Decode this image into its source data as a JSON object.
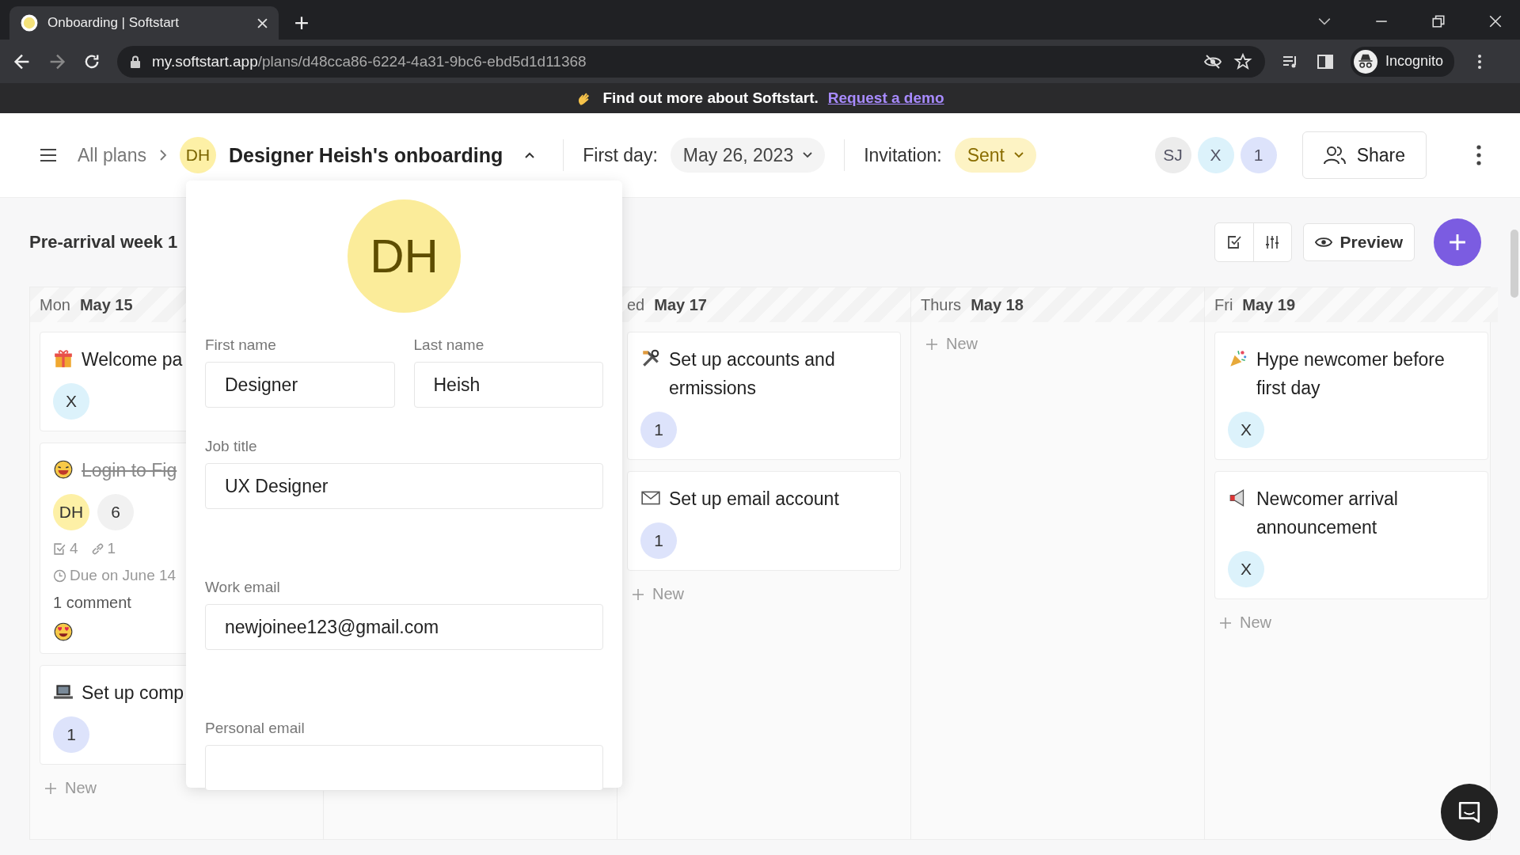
{
  "browser": {
    "tab": {
      "title": "Onboarding | Softstart"
    },
    "url": {
      "host": "my.softstart.app",
      "path": "/plans/d48cca86-6224-4a31-9bc6-ebd5d1d11368"
    },
    "profile": "Incognito"
  },
  "banner": {
    "text": "Find out more about Softstart.",
    "link": "Request a demo"
  },
  "header": {
    "breadcrumb": "All plans",
    "plan_avatar": "DH",
    "plan_title": "Designer Heish's onboarding",
    "first_day_label": "First day:",
    "first_day": "May 26, 2023",
    "invitation_label": "Invitation:",
    "invitation_status": "Sent",
    "members": [
      {
        "label": "SJ",
        "color": "#ececec"
      },
      {
        "label": "X",
        "color": "#dcf2fb"
      },
      {
        "label": "1",
        "color": "#dde3fb"
      }
    ],
    "share": "Share"
  },
  "toolbar": {
    "week_title": "Pre-arrival week 1",
    "preview": "Preview"
  },
  "columns": [
    {
      "day": "Mon",
      "date": "May 15",
      "new": "New",
      "cards": [
        {
          "title": "Welcome pa",
          "done": false,
          "assignees": [
            {
              "label": "X",
              "color": "#dcf2fb"
            }
          ]
        },
        {
          "title": "Login to Fig",
          "done": true,
          "assignees": [
            {
              "label": "DH",
              "color": "#fdf0a6"
            },
            {
              "label": "6",
              "color": "#f1f1f1"
            }
          ],
          "checklist": "4",
          "links": "1",
          "due": "Due on June 14",
          "comments": "1 comment"
        },
        {
          "title": "Set up comp",
          "done": false,
          "assignees": [
            {
              "label": "1",
              "color": "#dde3fb"
            }
          ]
        }
      ]
    },
    {},
    {
      "day": "ed",
      "date": "May 17",
      "new": "New",
      "cards": [
        {
          "title": "Set up accounts and\nermissions",
          "done": false,
          "assignees": [
            {
              "label": "1",
              "color": "#dde3fb"
            }
          ]
        },
        {
          "title": "Set up email account",
          "done": false,
          "assignees": [
            {
              "label": "1",
              "color": "#dde3fb"
            }
          ]
        }
      ]
    },
    {
      "day": "Thurs",
      "date": "May 18",
      "new": "New"
    },
    {
      "day": "Fri",
      "date": "May 19",
      "new": "New",
      "cards": [
        {
          "title": "Hype newcomer before first day",
          "done": false,
          "assignees": [
            {
              "label": "X",
              "color": "#dcf2fb"
            }
          ]
        },
        {
          "title": "Newcomer arrival announcement",
          "done": false,
          "assignees": [
            {
              "label": "X",
              "color": "#dcf2fb"
            }
          ]
        }
      ]
    }
  ],
  "profile_popover": {
    "avatar": "DH",
    "fields": [
      {
        "kind": "half",
        "label": "First name",
        "value": "Designer"
      },
      {
        "kind": "half",
        "label": "Last name",
        "value": "Heish"
      },
      {
        "kind": "full",
        "label": "Job title",
        "value": "UX Designer"
      },
      {
        "kind": "full",
        "label": "Work email",
        "value": "newjoinee123@gmail.com"
      },
      {
        "kind": "full",
        "label": "Personal email"
      }
    ]
  }
}
